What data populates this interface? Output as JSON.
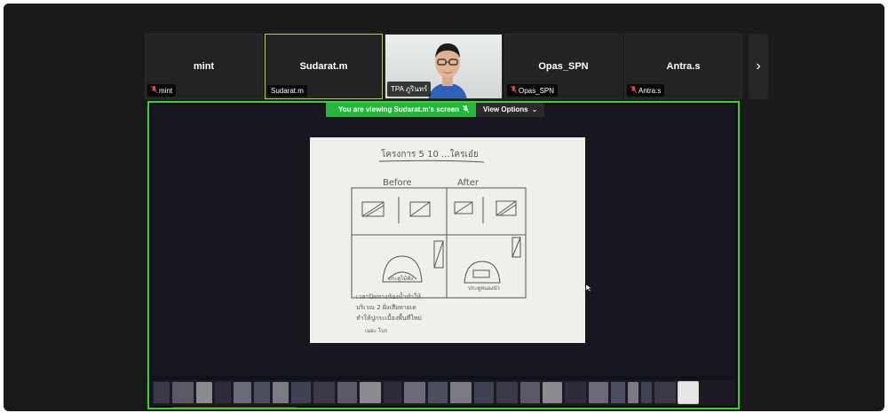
{
  "participants": [
    {
      "name": "mint",
      "label": "mint",
      "muted": true,
      "active": false,
      "video": false
    },
    {
      "name": "Sudarat.m",
      "label": "Sudarat.m",
      "muted": false,
      "active": true,
      "video": false
    },
    {
      "name": "",
      "label": "TPA ภูรินทร์",
      "muted": false,
      "active": false,
      "video": true
    },
    {
      "name": "Opas_SPN",
      "label": "Opas_SPN",
      "muted": true,
      "active": false,
      "video": false
    },
    {
      "name": "Antra.s",
      "label": "Antra.s",
      "muted": true,
      "active": false,
      "video": false
    }
  ],
  "strip": {
    "next_icon": "chevron-right-icon",
    "next_glyph": "›"
  },
  "banner": {
    "viewing_text": "You are viewing  Sudarat.m's screen",
    "options_label": "View Options",
    "options_glyph": "⌄"
  },
  "colors": {
    "share_border": "#3bd02c",
    "banner_green": "#23b83a",
    "active_tile_border": "#b4c870",
    "muted_icon": "#e04848"
  },
  "sketch": {
    "title": "โครงการ 5 10 ...ใครเอ๋ย",
    "before_label": "Before",
    "after_label": "After",
    "left_caption": "ประตูไม้พัง",
    "right_caption": "ประตูหนองบัว",
    "note_lines": [
      "เวลาปิดทางห้องน้ำทำให้",
      "บริเวณ 2 ฝั่งเสียหายเด",
      "ทำให้ปูกระเบื้องพื้นที่ใหม่",
      "เนอะ โบร"
    ]
  },
  "thumbnails": {
    "count": 26
  }
}
